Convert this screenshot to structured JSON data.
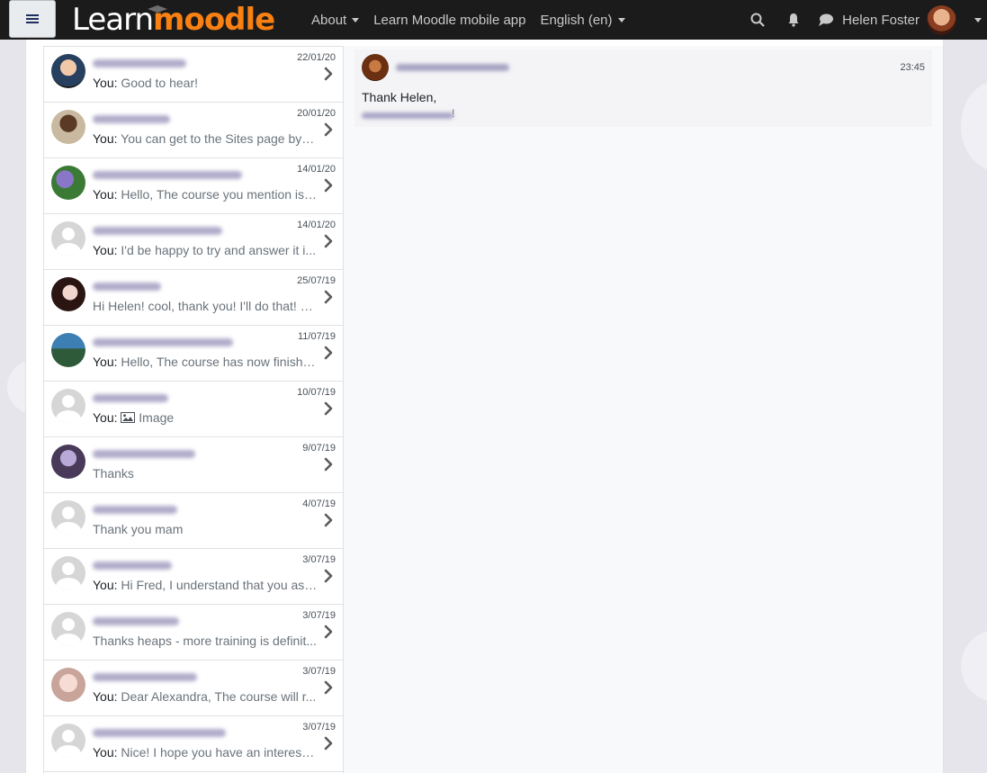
{
  "navbar": {
    "logo_learn": "Learn",
    "logo_moodle": "moodle",
    "links": [
      {
        "label": "About",
        "dropdown": true
      },
      {
        "label": "Learn Moodle mobile app",
        "dropdown": false
      },
      {
        "label": "English (en)",
        "dropdown": true
      }
    ],
    "user_name": "Helen Foster",
    "icons": [
      "search-icon",
      "bell-icon",
      "comment-icon"
    ]
  },
  "conversations": [
    {
      "date": "22/01/20",
      "you": "You:",
      "text": "Good to hear!",
      "avatar": "photo"
    },
    {
      "date": "20/01/20",
      "you": "You:",
      "text": "You can get to the Sites page by l...",
      "avatar": "photo"
    },
    {
      "date": "14/01/20",
      "you": "You:",
      "text": "Hello, The course you mention is ...",
      "avatar": "photo"
    },
    {
      "date": "14/01/20",
      "you": "You:",
      "text": "I'd be happy to try and answer it i...",
      "avatar": "default"
    },
    {
      "date": "25/07/19",
      "you": "",
      "text": "Hi Helen! cool, thank you! I'll do that! b...",
      "avatar": "photo"
    },
    {
      "date": "11/07/19",
      "you": "You:",
      "text": "Hello, The course has now finishe...",
      "avatar": "photo"
    },
    {
      "date": "10/07/19",
      "you": "You:",
      "text": "Image",
      "avatar": "default",
      "image_icon": true
    },
    {
      "date": "9/07/19",
      "you": "",
      "text": "Thanks",
      "avatar": "photo"
    },
    {
      "date": "4/07/19",
      "you": "",
      "text": "Thank you mam",
      "avatar": "default"
    },
    {
      "date": "3/07/19",
      "you": "You:",
      "text": "Hi Fred, I understand that you ask...",
      "avatar": "default"
    },
    {
      "date": "3/07/19",
      "you": "",
      "text": "Thanks heaps - more training is definit...",
      "avatar": "default"
    },
    {
      "date": "3/07/19",
      "you": "You:",
      "text": "Dear Alexandra, The course will r...",
      "avatar": "photo"
    },
    {
      "date": "3/07/19",
      "you": "You:",
      "text": "Nice! I hope you have an interesti...",
      "avatar": "default"
    }
  ],
  "message": {
    "time": "23:45",
    "text": "Thank Helen,",
    "signature_end": "!"
  },
  "colors": {
    "navbar_bg": "#1b1b1b",
    "accent_orange": "#f98012",
    "page_bg": "#e6e5ec"
  }
}
